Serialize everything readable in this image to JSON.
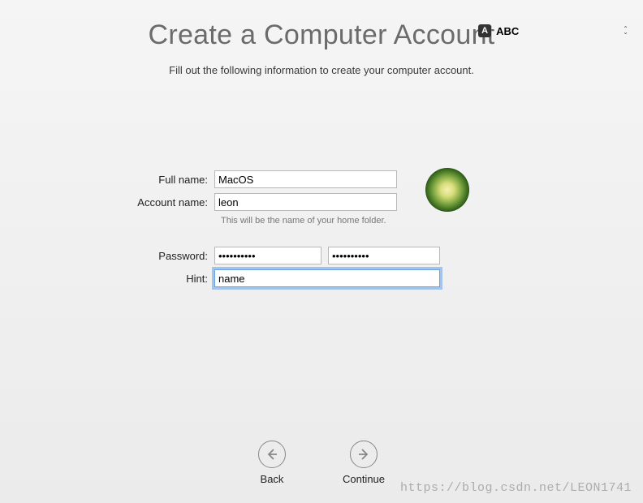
{
  "menubar": {
    "input_badge": "A",
    "input_label": "ABC"
  },
  "header": {
    "title": "Create a Computer Account",
    "subtitle": "Fill out the following information to create your computer account."
  },
  "form": {
    "full_name": {
      "label": "Full name:",
      "value": "MacOS"
    },
    "account_name": {
      "label": "Account name:",
      "value": "leon",
      "helper": "This will be the name of your home folder."
    },
    "password": {
      "label": "Password:",
      "value": "••••••••••",
      "confirm_value": "••••••••••"
    },
    "hint": {
      "label": "Hint:",
      "value": "name"
    }
  },
  "avatar": {
    "name": "dandelion"
  },
  "nav": {
    "back": "Back",
    "continue": "Continue"
  },
  "watermark": "https://blog.csdn.net/LEON1741"
}
